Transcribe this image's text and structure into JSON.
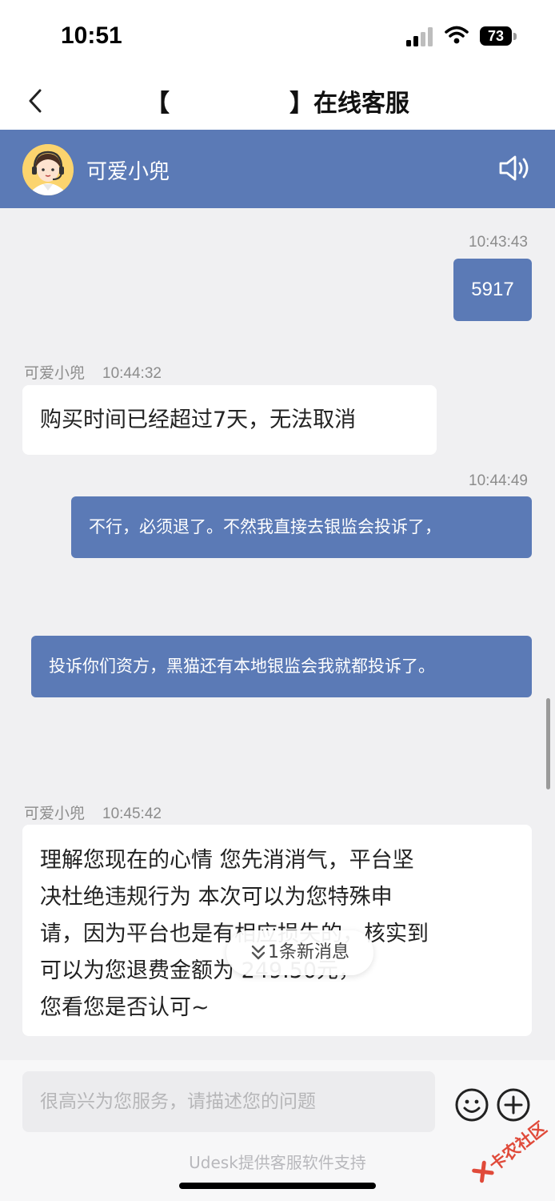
{
  "status_bar": {
    "time": "10:51",
    "battery": "73"
  },
  "nav": {
    "title": "【　　　　　】在线客服"
  },
  "agent": {
    "name": "可爱小兜"
  },
  "messages": {
    "m1": {
      "time": "10:43:43",
      "text": "5917"
    },
    "m2": {
      "sender": "可爱小兜",
      "time": "10:44:32",
      "text": "购买时间已经超过7天，无法取消"
    },
    "m3": {
      "time": "10:44:49",
      "text": "不行，必须退了。不然我直接去银监会投诉了，"
    },
    "m4": {
      "text": "投诉你们资方，黑猫还有本地银监会我就都投诉了。"
    },
    "m5": {
      "sender": "可爱小兜",
      "time": "10:45:42",
      "lines": [
        "理解您现在的心情 您先消消气，平台坚",
        "决杜绝违规行为 本次可以为您特殊申",
        "请，因为平台也是有相应损失的，核实到",
        "可以为您退费金额为 249.50元，",
        "您看您是否认可~"
      ]
    }
  },
  "new_message_pill": "1条新消息",
  "input": {
    "placeholder": "很高兴为您服务，请描述您的问题"
  },
  "footer": {
    "note": "Udesk提供客服软件支持"
  },
  "watermark": "卡农社区",
  "icons": {
    "back": "chevron-left-icon",
    "speaker": "speaker-icon",
    "emoji": "smile-icon",
    "plus": "plus-circle-icon",
    "chevron": "double-chevron-down-icon"
  },
  "colors": {
    "accent": "#5b7ab6",
    "background": "#f0f0f2",
    "avatar_bg": "#fbd46e"
  }
}
